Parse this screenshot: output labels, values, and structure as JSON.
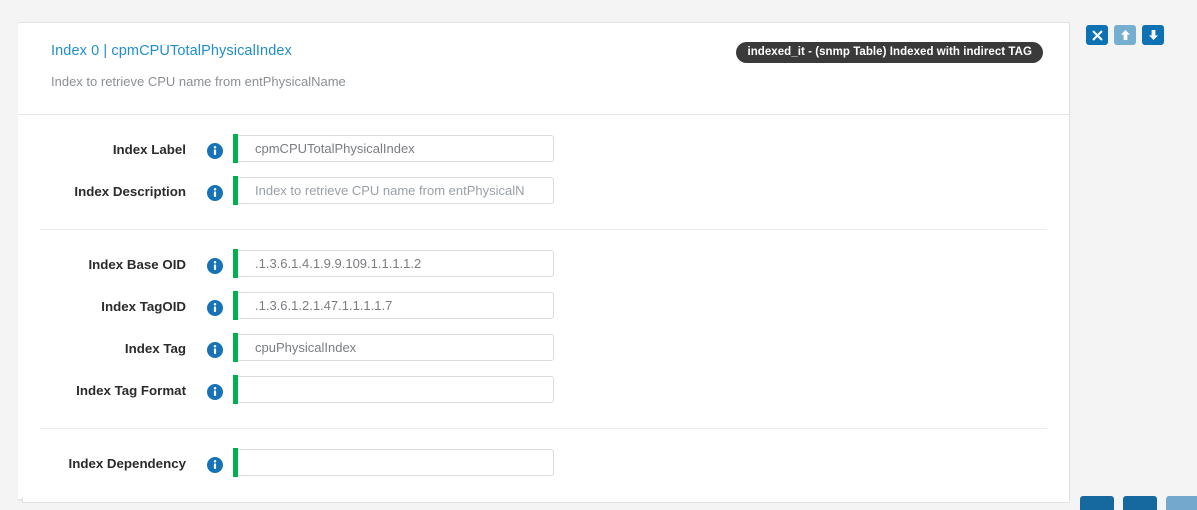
{
  "panel": {
    "title": "Index 0 | cpmCPUTotalPhysicalIndex",
    "subtitle": "Index to retrieve CPU name from entPhysicalName",
    "badge": "indexed_it - (snmp Table) Indexed with indirect TAG",
    "accent_color": "#00b04f",
    "badge_bg": "#3a3a3a",
    "link_color": "#1f8ecd"
  },
  "controls": {
    "close": {
      "name": "close-button",
      "glyph": "x"
    },
    "move_up": {
      "name": "move-up-button",
      "glyph": "up-arrow"
    },
    "move_down": {
      "name": "move-down-button",
      "glyph": "down-arrow"
    }
  },
  "groups": [
    {
      "fields": [
        {
          "label": "Index Label",
          "value": "cpmCPUTotalPhysicalIndex",
          "placeholder": "",
          "info": "info-icon"
        },
        {
          "label": "Index Description",
          "value": "",
          "placeholder": "Index to retrieve CPU name from entPhysicalN",
          "info": "info-icon"
        }
      ]
    },
    {
      "fields": [
        {
          "label": "Index Base OID",
          "value": ".1.3.6.1.4.1.9.9.109.1.1.1.1.2",
          "placeholder": "",
          "info": "info-icon"
        },
        {
          "label": "Index TagOID",
          "value": ".1.3.6.1.2.1.47.1.1.1.1.7",
          "placeholder": "",
          "info": "info-icon"
        },
        {
          "label": "Index Tag",
          "value": "cpuPhysicalIndex",
          "placeholder": "",
          "info": "info-icon"
        },
        {
          "label": "Index Tag Format",
          "value": "",
          "placeholder": "",
          "info": "info-icon"
        }
      ]
    },
    {
      "fields": [
        {
          "label": "Index Dependency",
          "value": "",
          "placeholder": "",
          "info": "info-icon"
        }
      ]
    }
  ],
  "footer": {
    "buttons": [
      {
        "name": "footer-primary-button",
        "tone": "dark"
      },
      {
        "name": "footer-secondary-button",
        "tone": "dark"
      },
      {
        "name": "footer-tertiary-button",
        "tone": "light"
      }
    ]
  }
}
